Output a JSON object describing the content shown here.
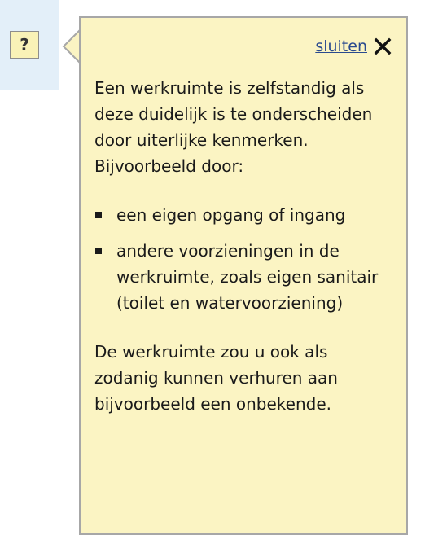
{
  "help_button": {
    "label": "?"
  },
  "tooltip": {
    "close_label": "sluiten",
    "close_icon": "close-x-icon",
    "intro": "Een werkruimte is zelfstandig als deze duidelijk is te onderscheiden door uiterlijke kenmerken. Bijvoorbeeld door:",
    "bullets": [
      "een eigen opgang of ingang",
      "andere voorzieningen in de werkruimte, zoals eigen sanitair (toilet en watervoorziening)"
    ],
    "outro": "De werkruimte zou u ook als zodanig kunnen verhuren aan bijvoorbeeld een onbekende."
  },
  "colors": {
    "panel_background": "#e3eff9",
    "tooltip_background": "#fbf4c3",
    "tooltip_border": "#a7a7a7",
    "link": "#2a4a8e"
  }
}
